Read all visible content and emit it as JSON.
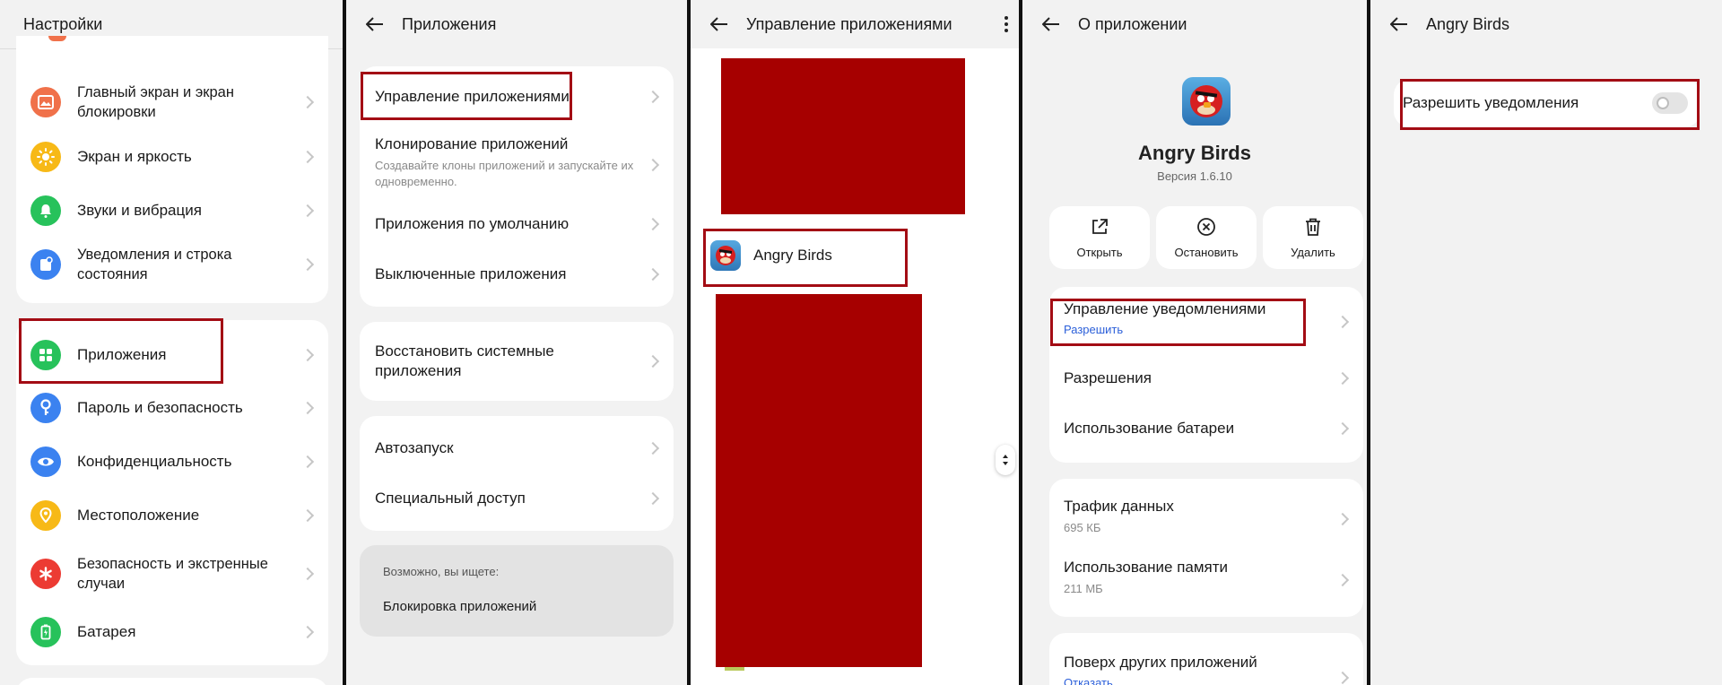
{
  "panel1": {
    "title": "Настройки",
    "items_group1": [
      {
        "label": "Главный экран и экран блокировки",
        "icon": "home-screen-icon",
        "color": "#f0714a"
      },
      {
        "label": "Экран и яркость",
        "icon": "sun-icon",
        "color": "#f7b917"
      },
      {
        "label": "Звуки и вибрация",
        "icon": "bell-icon",
        "color": "#27c25b"
      },
      {
        "label": "Уведомления и строка состояния",
        "icon": "notification-icon",
        "color": "#3b82f0"
      }
    ],
    "items_group2": [
      {
        "label": "Приложения",
        "icon": "apps-grid-icon",
        "color": "#27c25b"
      },
      {
        "label": "Пароль и безопасность",
        "icon": "key-icon",
        "color": "#3b82f0"
      },
      {
        "label": "Конфиденциальность",
        "icon": "eye-icon",
        "color": "#3b82f0"
      },
      {
        "label": "Местоположение",
        "icon": "location-icon",
        "color": "#f7b917"
      },
      {
        "label": "Безопасность и экстренные случаи",
        "icon": "asterisk-icon",
        "color": "#ec3b33"
      },
      {
        "label": "Батарея",
        "icon": "battery-icon",
        "color": "#27c25b"
      }
    ]
  },
  "panel2": {
    "title": "Приложения",
    "group1": [
      {
        "label": "Управление приложениями"
      },
      {
        "label": "Клонирование приложений",
        "sub": "Создавайте клоны приложений и запускайте их одновременно."
      },
      {
        "label": "Приложения по умолчанию"
      },
      {
        "label": "Выключенные приложения"
      }
    ],
    "group2": [
      {
        "label": "Восстановить системные приложения"
      }
    ],
    "group3": [
      {
        "label": "Автозапуск"
      },
      {
        "label": "Специальный доступ"
      }
    ],
    "suggest": {
      "caption": "Возможно, вы ищете:",
      "item": "Блокировка приложений"
    }
  },
  "panel3": {
    "title": "Управление приложениями",
    "app_name": "Angry Birds"
  },
  "panel4": {
    "title": "О приложении",
    "app_name": "Angry Birds",
    "version": "Версия 1.6.10",
    "actions": [
      {
        "label": "Открыть",
        "icon": "open-external-icon"
      },
      {
        "label": "Остановить",
        "icon": "stop-circle-icon"
      },
      {
        "label": "Удалить",
        "icon": "trash-icon"
      }
    ],
    "group1": [
      {
        "label": "Управление уведомлениями",
        "sub": "Разрешить"
      },
      {
        "label": "Разрешения"
      },
      {
        "label": "Использование батареи"
      }
    ],
    "group2": [
      {
        "label": "Трафик данных",
        "sub": "695 КБ"
      },
      {
        "label": "Использование памяти",
        "sub": "211 МБ"
      }
    ],
    "group3": [
      {
        "label": "Поверх других приложений",
        "sub": "Отказать"
      }
    ]
  },
  "panel5": {
    "title": "Angry Birds",
    "toggle_label": "Разрешить уведомления",
    "toggle_on": false
  },
  "colors": {
    "highlight_border": "#a30c14",
    "redaction": "#a60000",
    "accent_blue": "#2b5fd9"
  }
}
